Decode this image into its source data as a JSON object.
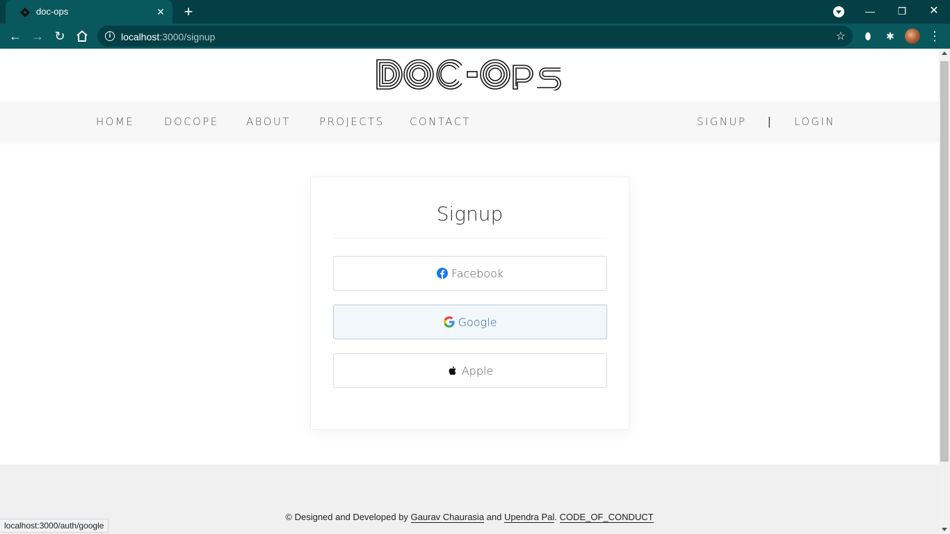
{
  "browser": {
    "tab_title": "doc-ops",
    "url_host": "localhost",
    "url_path": ":3000/signup",
    "status_url": "localhost:3000/auth/google"
  },
  "site": {
    "logo_text": "DOC-OPS",
    "nav": {
      "left": [
        "HOME",
        "DOCOPE",
        "ABOUT",
        "PROJECTS",
        "CONTACT"
      ],
      "signup": "SIGNUP",
      "separator": "|",
      "login": "LOGIN"
    }
  },
  "signup": {
    "title": "Signup",
    "buttons": {
      "facebook": "Facebook",
      "google": "Google",
      "apple": "Apple"
    }
  },
  "footer": {
    "prefix": "© Designed and Developed by",
    "author1": "Gaurav Chaurasia",
    "and": "and",
    "author2": "Upendra Pal",
    "dot": ".",
    "conduct": "CODE_OF_CONDUCT"
  },
  "colors": {
    "chrome_dark": "#033f45",
    "chrome_tab": "#08585e",
    "facebook": "#1877f2",
    "google_btn_bg": "#f2f7fc"
  },
  "icons": [
    "favicon-icon",
    "close-icon",
    "plus-icon",
    "back-icon",
    "forward-icon",
    "reload-icon",
    "home-icon",
    "info-icon",
    "star-icon",
    "extensions-icon",
    "facebook-icon",
    "google-icon",
    "apple-icon"
  ]
}
